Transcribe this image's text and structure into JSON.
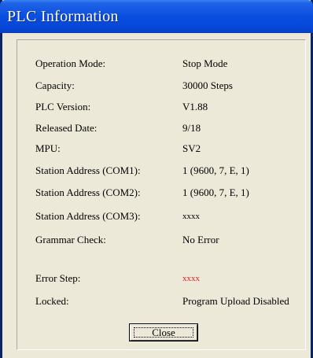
{
  "window": {
    "title": "PLC Information"
  },
  "info": {
    "rows": [
      {
        "label": "Operation Mode:",
        "value": "Stop Mode"
      },
      {
        "label": "Capacity:",
        "value": "30000 Steps"
      },
      {
        "label": "PLC Version:",
        "value": "V1.88"
      },
      {
        "label": "Released Date:",
        "value": "9/18"
      },
      {
        "label": "MPU:",
        "value": "SV2"
      },
      {
        "label": "Station Address (COM1):",
        "value": "1 (9600, 7, E, 1)"
      },
      {
        "label": "Station Address (COM2):",
        "value": "1 (9600, 7, E, 1)"
      },
      {
        "label": "Station Address (COM3):",
        "value": "xxxx"
      },
      {
        "label": "Grammar Check:",
        "value": "No Error"
      },
      {
        "label": "Error Step:",
        "value": "xxxx"
      },
      {
        "label": "Locked:",
        "value": "Program Upload Disabled"
      }
    ]
  },
  "buttons": {
    "close_label": "Close"
  },
  "colors": {
    "error_value": "#e02020",
    "titlebar": "#0a4ee0",
    "dialog_bg": "#ece9d8"
  }
}
